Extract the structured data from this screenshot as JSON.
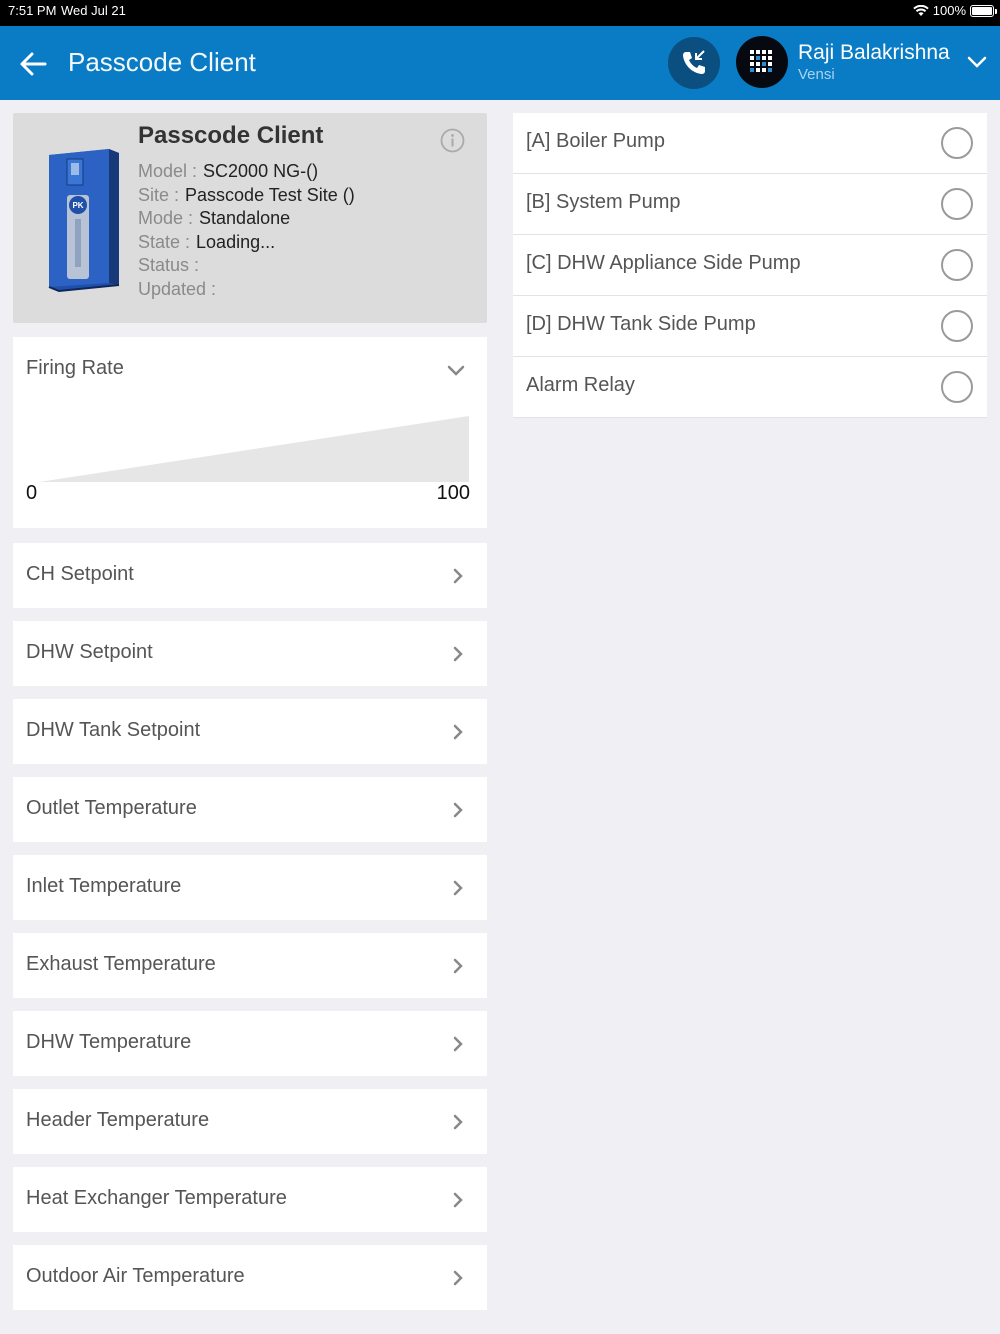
{
  "status_bar": {
    "time": "7:51 PM",
    "date": "Wed Jul 21",
    "battery": "100%"
  },
  "header": {
    "title": "Passcode Client",
    "user_name": "Raji Balakrishna",
    "user_org": "Vensi"
  },
  "device": {
    "title": "Passcode Client",
    "rows": [
      {
        "label": "Model :",
        "value": "SC2000 NG-()"
      },
      {
        "label": "Site :",
        "value": "Passcode Test Site ()"
      },
      {
        "label": "Mode :",
        "value": "Standalone"
      },
      {
        "label": "State :",
        "value": "Loading..."
      },
      {
        "label": "Status :",
        "value": ""
      },
      {
        "label": "Updated :",
        "value": ""
      }
    ]
  },
  "firing_rate": {
    "title": "Firing Rate",
    "min": "0",
    "max": "100"
  },
  "items": [
    "CH Setpoint",
    "DHW Setpoint",
    "DHW Tank Setpoint",
    "Outlet Temperature",
    "Inlet Temperature",
    "Exhaust Temperature",
    "DHW Temperature",
    "Header Temperature",
    "Heat Exchanger Temperature",
    "Outdoor Air Temperature"
  ],
  "relays": [
    {
      "label": "[A] Boiler Pump",
      "checked": false
    },
    {
      "label": "[B] System Pump",
      "checked": false
    },
    {
      "label": "[C] DHW Appliance Side Pump",
      "checked": false
    },
    {
      "label": "[D] DHW Tank Side Pump",
      "checked": false
    },
    {
      "label": "Alarm Relay",
      "checked": false
    }
  ],
  "colors": {
    "header_bg": "#0a7bc5",
    "call_button_bg": "#0b4e80",
    "page_bg": "#efeff4"
  }
}
